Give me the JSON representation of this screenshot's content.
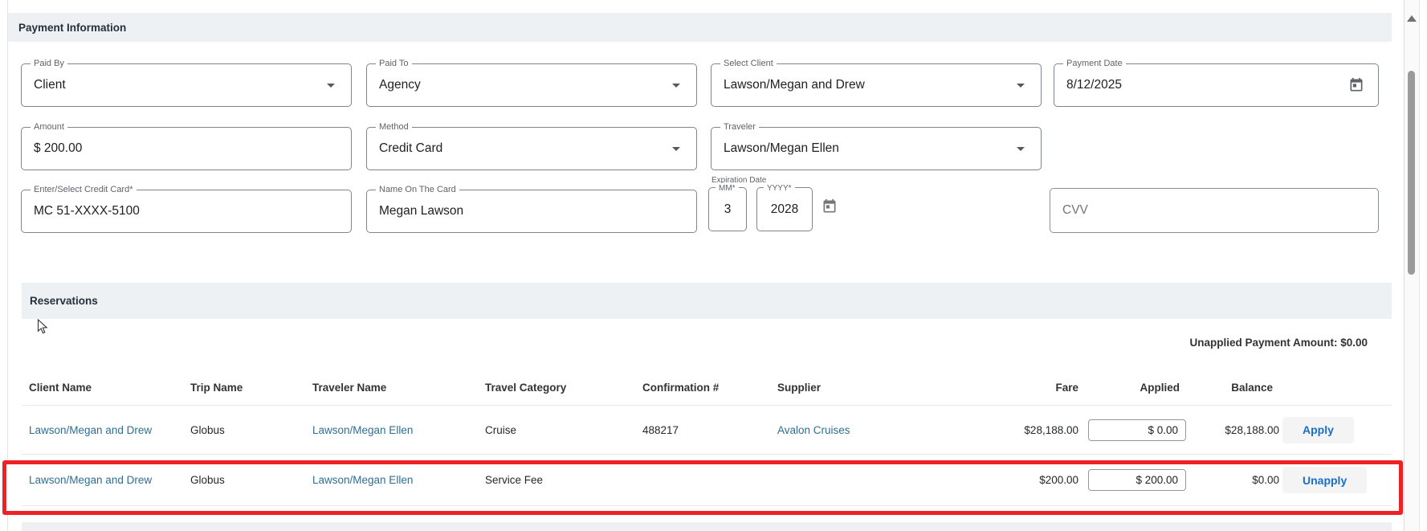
{
  "payment_form": {
    "section_title": "Payment Information",
    "fields": {
      "paid_by": {
        "label": "Paid By",
        "value": "Client"
      },
      "paid_to": {
        "label": "Paid To",
        "value": "Agency"
      },
      "select_client": {
        "label": "Select Client",
        "value": "Lawson/Megan and Drew"
      },
      "payment_date": {
        "label": "Payment Date",
        "value": "8/12/2025"
      },
      "amount": {
        "label": "Amount",
        "value": "$ 200.00"
      },
      "method": {
        "label": "Method",
        "value": "Credit Card"
      },
      "traveler": {
        "label": "Traveler",
        "value": "Lawson/Megan Ellen"
      },
      "credit_card": {
        "label": "Enter/Select Credit Card*",
        "value": "MC 51-XXXX-5100"
      },
      "name_on_card": {
        "label": "Name On The Card",
        "value": "Megan Lawson"
      },
      "expiration": {
        "group_label": "Expiration Date",
        "mm_label": "MM*",
        "mm_value": "3",
        "yyyy_label": "YYYY*",
        "yyyy_value": "2028"
      },
      "cvv": {
        "placeholder": "CVV",
        "value": ""
      }
    }
  },
  "reservations": {
    "section_title": "Reservations",
    "unapplied_label": "Unapplied Payment Amount: $0.00",
    "table": {
      "headers": [
        "Client Name",
        "Trip Name",
        "Traveler Name",
        "Travel Category",
        "Confirmation #",
        "Supplier",
        "Fare",
        "Applied",
        "Balance"
      ],
      "rows": [
        {
          "client": "Lawson/Megan and Drew",
          "trip": "Globus",
          "traveler": "Lawson/Megan Ellen",
          "category": "Cruise",
          "confirmation": "488217",
          "supplier": "Avalon Cruises",
          "fare": "$28,188.00",
          "applied": "$ 0.00",
          "balance": "$28,188.00",
          "action": "Apply",
          "highlighted": false
        },
        {
          "client": "Lawson/Megan and Drew",
          "trip": "Globus",
          "traveler": "Lawson/Megan Ellen",
          "category": "Service Fee",
          "confirmation": "",
          "supplier": "",
          "fare": "$200.00",
          "applied": "$ 200.00",
          "balance": "$0.00",
          "action": "Unapply",
          "highlighted": true
        }
      ]
    }
  },
  "icons": {
    "payment_date": "calendar-icon",
    "expiration": "calendar-icon",
    "dropdowns": "chevron-down-icon",
    "scrollbar_top": "scroll-up-arrow",
    "pointer": "mouse-cursor"
  },
  "colors": {
    "section_bar_bg": "#edf1f4",
    "highlight_border": "#ee2224",
    "link_text": "#2f6e91",
    "button_text": "#1a6ec5",
    "button_bg": "#f4f4f4",
    "field_border": "#7f858a",
    "label_text": "#5f6368"
  }
}
